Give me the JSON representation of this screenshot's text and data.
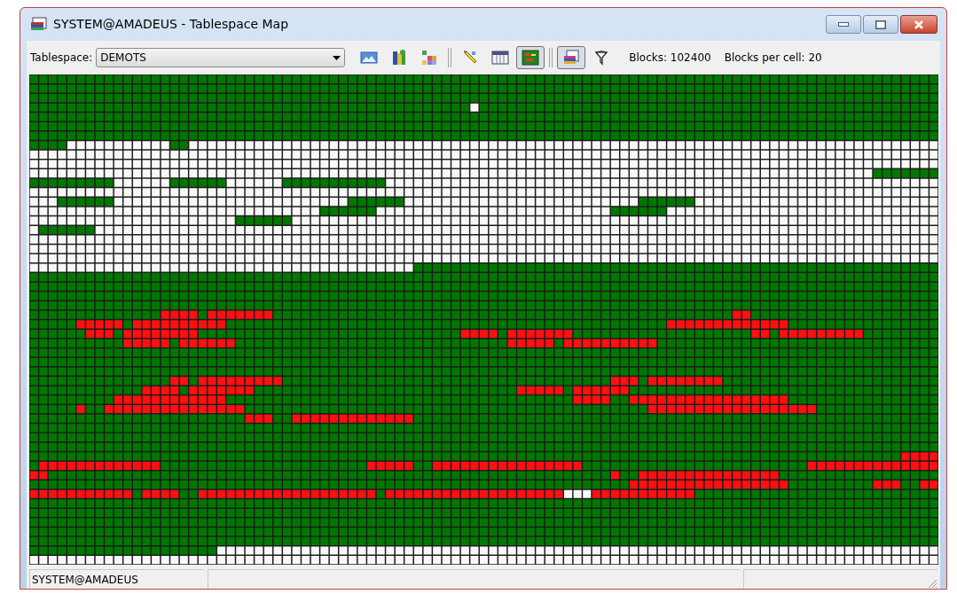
{
  "window": {
    "title": "SYSTEM@AMADEUS - Tablespace Map"
  },
  "toolbar": {
    "tablespace_label": "Tablespace:",
    "tablespace_value": "DEMOTS",
    "groups": [
      [
        {
          "kind": "chart",
          "pressed": false
        },
        {
          "kind": "stack",
          "pressed": false
        },
        {
          "kind": "tiles",
          "pressed": false
        }
      ],
      [
        {
          "kind": "wand",
          "pressed": false
        },
        {
          "kind": "table",
          "pressed": false
        },
        {
          "kind": "map",
          "pressed": true
        }
      ],
      [
        {
          "kind": "layers",
          "pressed": true
        },
        {
          "kind": "filter",
          "pressed": false
        }
      ]
    ],
    "blocks": "Blocks: 102400",
    "blocks_per_cell": "Blocks per cell: 20"
  },
  "status_bar": {
    "panes": [
      "SYSTEM@AMADEUS"
    ]
  }
}
